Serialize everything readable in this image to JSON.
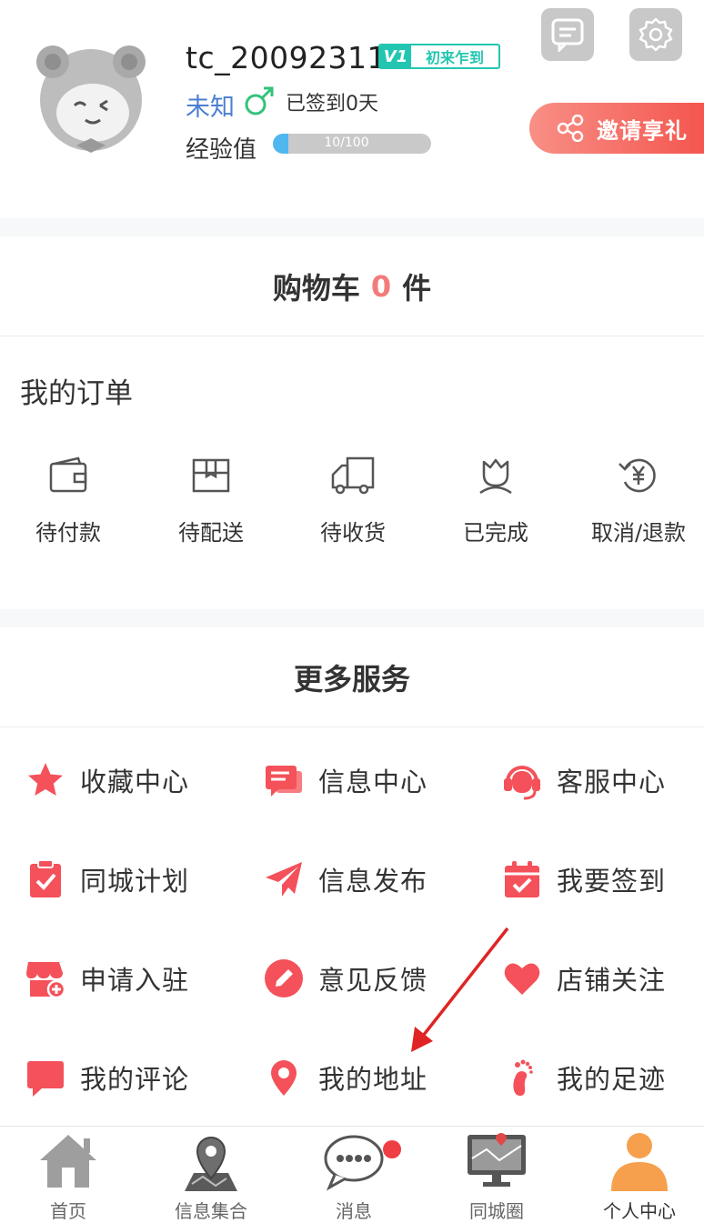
{
  "colors": {
    "accent": "#f4515a",
    "teal": "#22c6b0",
    "exp_fill": "#4fb7f0",
    "cart_count": "#f47b7b"
  },
  "profile": {
    "username": "tc_20092311",
    "vip_level": "V1",
    "vip_title": "初来乍到",
    "gender_text": "未知",
    "gender_icon": "male-symbol-icon",
    "signin_text": "已签到0天",
    "exp_label": "经验值",
    "exp_text": "10/100",
    "exp_progress": 0.1,
    "invite_label": "邀请享礼"
  },
  "cart": {
    "label": "购物车",
    "count": "0",
    "unit": "件"
  },
  "orders": {
    "title": "我的订单",
    "items": [
      {
        "label": "待付款",
        "icon": "wallet-icon"
      },
      {
        "label": "待配送",
        "icon": "package-icon"
      },
      {
        "label": "待收货",
        "icon": "truck-icon"
      },
      {
        "label": "已完成",
        "icon": "flower-icon"
      },
      {
        "label": "取消/退款",
        "icon": "refund-icon"
      }
    ]
  },
  "services": {
    "title": "更多服务",
    "items": [
      {
        "label": "收藏中心",
        "icon": "star-icon"
      },
      {
        "label": "信息中心",
        "icon": "chat-icon"
      },
      {
        "label": "客服中心",
        "icon": "headset-icon"
      },
      {
        "label": "同城计划",
        "icon": "clipboard-check-icon"
      },
      {
        "label": "信息发布",
        "icon": "paper-plane-icon"
      },
      {
        "label": "我要签到",
        "icon": "calendar-check-icon"
      },
      {
        "label": "申请入驻",
        "icon": "store-add-icon"
      },
      {
        "label": "意见反馈",
        "icon": "pencil-icon"
      },
      {
        "label": "店铺关注",
        "icon": "heart-icon"
      },
      {
        "label": "我的评论",
        "icon": "comment-icon"
      },
      {
        "label": "我的地址",
        "icon": "location-pin-icon"
      },
      {
        "label": "我的足迹",
        "icon": "footprint-icon"
      }
    ]
  },
  "tabbar": {
    "items": [
      {
        "label": "首页",
        "icon": "home-icon"
      },
      {
        "label": "信息集合",
        "icon": "map-pin-icon"
      },
      {
        "label": "消息",
        "icon": "message-bubble-icon"
      },
      {
        "label": "同城圈",
        "icon": "monitor-map-icon"
      },
      {
        "label": "个人中心",
        "icon": "person-icon"
      }
    ],
    "active": "个人中心"
  }
}
